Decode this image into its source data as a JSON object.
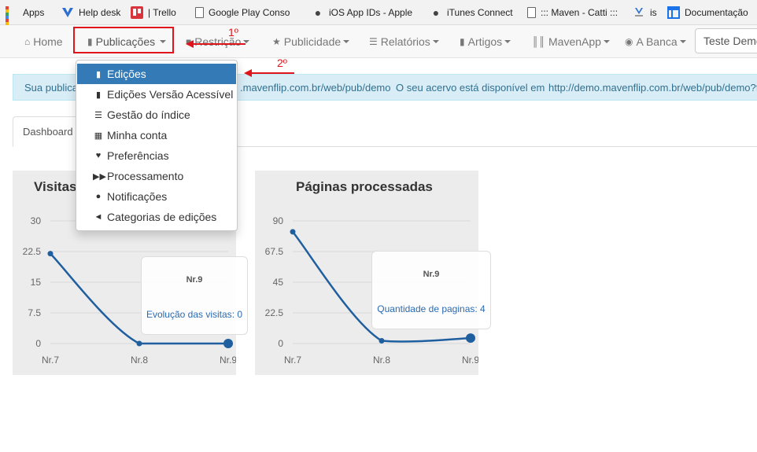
{
  "bookmarks": [
    {
      "label": "Apps",
      "icon": "apps-grid-icon"
    },
    {
      "label": "Help desk",
      "icon": "helpdesk-v-icon"
    },
    {
      "label": "| Trello",
      "icon": "trello-icon"
    },
    {
      "label": "Google Play Console",
      "icon": "document-icon"
    },
    {
      "label": "iOS App IDs - Apple",
      "icon": "apple-icon"
    },
    {
      "label": "iTunes Connect",
      "icon": "apple-icon"
    },
    {
      "label": "::: Maven - Catti :::",
      "icon": "document-icon"
    },
    {
      "label": "is",
      "icon": "maven-logo-icon"
    },
    {
      "label": "Documentação",
      "icon": "layout-icon"
    }
  ],
  "nav": {
    "home": "Home",
    "publicacoes": "Publicações",
    "restricao": "Restrição",
    "publicidade": "Publicidade",
    "relatorios": "Relatórios",
    "artigos": "Artigos",
    "mavenapp": "MavenApp",
    "abanca": "A Banca",
    "search_value": "Teste Demo"
  },
  "annotations": {
    "step1": "1º",
    "step2": "2º"
  },
  "info_bar": {
    "prefix": "Sua publicação",
    "url1": ".mavenflip.com.br/web/pub/demo",
    "text2": "O seu acervo está disponível em",
    "url2": "http://demo.mavenflip.com.br/web/pub/demo?f"
  },
  "tabs": {
    "dashboard": "Dashboard"
  },
  "dropdown": {
    "items": [
      {
        "label": "Edições",
        "icon": "book-icon",
        "active": true
      },
      {
        "label": "Edições Versão Acessível",
        "icon": "book-icon",
        "active": false
      },
      {
        "label": "Gestão do índice",
        "icon": "list-icon",
        "active": false
      },
      {
        "label": "Minha conta",
        "icon": "grid-icon",
        "active": false
      },
      {
        "label": "Preferências",
        "icon": "heart-icon",
        "active": false
      },
      {
        "label": "Processamento",
        "icon": "fast-forward-icon",
        "active": false
      },
      {
        "label": "Notificações",
        "icon": "comment-icon",
        "active": false
      },
      {
        "label": "Categorias de edições",
        "icon": "bullhorn-icon",
        "active": false
      }
    ]
  },
  "colors": {
    "accent": "#337ab7",
    "line": "#1f5f9f",
    "annotation": "#e0141b",
    "panel_bg": "#ececec"
  },
  "chart_data": [
    {
      "type": "line",
      "title": "Visitas",
      "x": [
        "Nr.7",
        "Nr.8",
        "Nr.9"
      ],
      "yticks": [
        "0",
        "7.5",
        "15",
        "22.5",
        "30"
      ],
      "ylim": [
        0,
        30
      ],
      "series": [
        {
          "name": "Evolução das visitas",
          "values": [
            22,
            0,
            0
          ]
        }
      ],
      "tooltip": {
        "title": "Nr.9",
        "series": "Evolução das visitas",
        "value": "0"
      },
      "grid": true
    },
    {
      "type": "line",
      "title": "Páginas processadas",
      "x": [
        "Nr.7",
        "Nr.8",
        "Nr.9"
      ],
      "yticks": [
        "0",
        "22.5",
        "45",
        "67.5",
        "90"
      ],
      "ylim": [
        0,
        90
      ],
      "series": [
        {
          "name": "Quantidade de paginas",
          "values": [
            82,
            2,
            4
          ]
        }
      ],
      "tooltip": {
        "title": "Nr.9",
        "series": "Quantidade de paginas",
        "value": "4"
      },
      "grid": true
    }
  ]
}
